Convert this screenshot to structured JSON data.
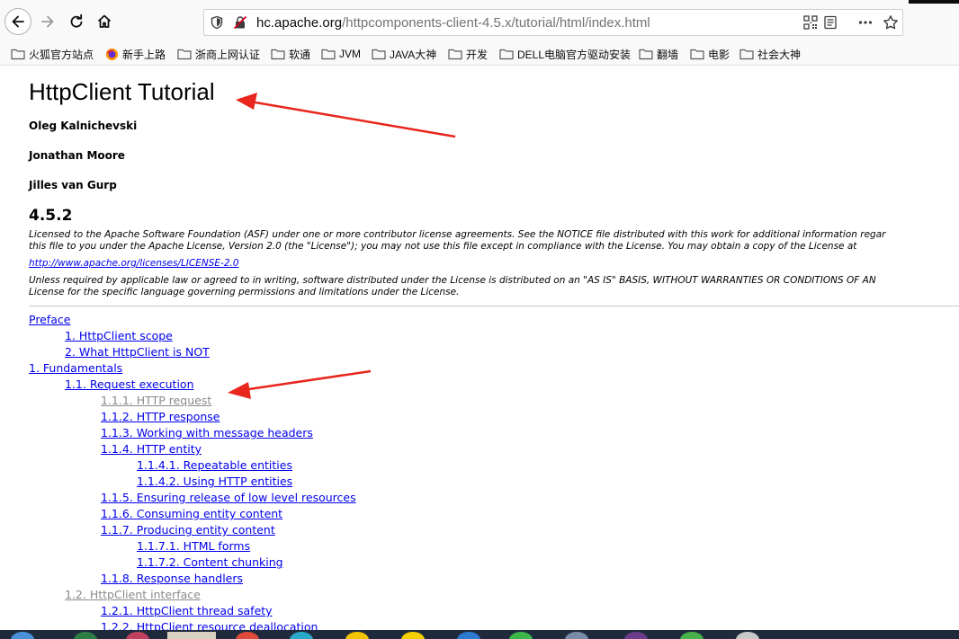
{
  "browser": {
    "url_domain": "hc.apache.org",
    "url_path": "/httpcomponents-client-4.5.x/tutorial/html/index.html",
    "nav_icons": [
      "back-arrow-icon",
      "forward-arrow-icon",
      "reload-icon",
      "home-icon"
    ],
    "urlbar_icons": [
      "shield-icon",
      "insecure-lock-icon",
      "qr-code-icon",
      "reader-view-icon",
      "more-dots-icon",
      "bookmark-star-icon"
    ]
  },
  "bookmarks": [
    {
      "label": "火狐官方站点",
      "icon": "folder-icon"
    },
    {
      "label": "新手上路",
      "icon": "firefox-icon"
    },
    {
      "label": "浙商上网认证",
      "icon": "folder-icon"
    },
    {
      "label": "软通",
      "icon": "folder-icon"
    },
    {
      "label": "JVM",
      "icon": "folder-icon"
    },
    {
      "label": "JAVA大神",
      "icon": "folder-icon"
    },
    {
      "label": "开发",
      "icon": "folder-icon"
    },
    {
      "label": "DELL电脑官方驱动安装",
      "icon": "folder-icon"
    },
    {
      "label": "翻墙",
      "icon": "folder-icon"
    },
    {
      "label": "电影",
      "icon": "folder-icon"
    },
    {
      "label": "社会大神",
      "icon": "folder-icon"
    }
  ],
  "page": {
    "title": "HttpClient Tutorial",
    "authors": [
      "Oleg Kalnichevski",
      "Jonathan Moore",
      "Jilles van Gurp"
    ],
    "version": "4.5.2",
    "legal_line1": "Licensed to the Apache Software Foundation (ASF) under one or more contributor license agreements. See the NOTICE file distributed with this work for additional information regar",
    "legal_line2": "this file to you under the Apache License, Version 2.0 (the \"License\"); you may not use this file except in compliance with the License. You may obtain a copy of the License at",
    "license_url": "http://www.apache.org/licenses/LICENSE-2.0",
    "legal_line3": "Unless required by applicable law or agreed to in writing, software distributed under the License is distributed on an \"AS IS\" BASIS, WITHOUT WARRANTIES OR CONDITIONS OF AN",
    "legal_line4": "License for the specific language governing permissions and limitations under the License."
  },
  "toc": [
    {
      "label": "Preface",
      "level": 0,
      "visited": false
    },
    {
      "label": "1. HttpClient scope",
      "level": 1,
      "visited": false
    },
    {
      "label": "2. What HttpClient is NOT",
      "level": 1,
      "visited": false
    },
    {
      "label": "1. Fundamentals",
      "level": 0,
      "visited": false
    },
    {
      "label": "1.1. Request execution",
      "level": 1,
      "visited": false
    },
    {
      "label": "1.1.1. HTTP request",
      "level": 2,
      "visited": true
    },
    {
      "label": "1.1.2. HTTP response",
      "level": 2,
      "visited": false
    },
    {
      "label": "1.1.3. Working with message headers",
      "level": 2,
      "visited": false
    },
    {
      "label": "1.1.4. HTTP entity",
      "level": 2,
      "visited": false
    },
    {
      "label": "1.1.4.1. Repeatable entities",
      "level": 3,
      "visited": false
    },
    {
      "label": "1.1.4.2. Using HTTP entities",
      "level": 3,
      "visited": false
    },
    {
      "label": "1.1.5. Ensuring release of low level resources",
      "level": 2,
      "visited": false
    },
    {
      "label": "1.1.6. Consuming entity content",
      "level": 2,
      "visited": false
    },
    {
      "label": "1.1.7. Producing entity content",
      "level": 2,
      "visited": false
    },
    {
      "label": "1.1.7.1. HTML forms",
      "level": 3,
      "visited": false
    },
    {
      "label": "1.1.7.2. Content chunking",
      "level": 3,
      "visited": false
    },
    {
      "label": "1.1.8. Response handlers",
      "level": 2,
      "visited": false
    },
    {
      "label": "1.2. HttpClient interface",
      "level": 1,
      "visited": true
    },
    {
      "label": "1.2.1. HttpClient thread safety",
      "level": 2,
      "visited": false
    },
    {
      "label": "1.2.2. HttpClient resource deallocation",
      "level": 2,
      "visited": false
    }
  ],
  "colors": {
    "link": "#0000ee",
    "visited": "#8a8a8a",
    "annotation_arrow": "#e8261d",
    "toolbar": "#f9f9fa"
  }
}
